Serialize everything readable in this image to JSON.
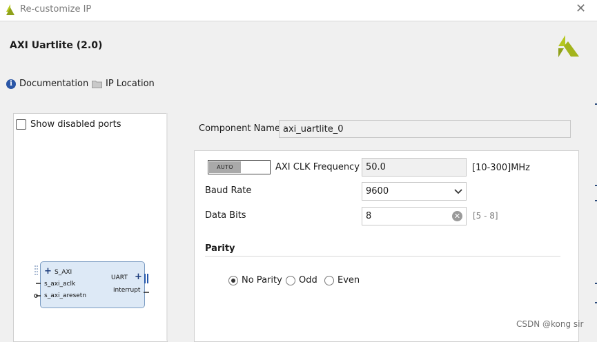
{
  "window": {
    "title": "Re-customize IP"
  },
  "header": {
    "ip_name": "AXI Uartlite (2.0)"
  },
  "links": {
    "documentation": "Documentation",
    "ip_location": "IP Location"
  },
  "left_panel": {
    "show_disabled_ports": "Show disabled ports",
    "block": {
      "left_ports": [
        "S_AXI",
        "s_axi_aclk",
        "s_axi_aresetn"
      ],
      "right_ports": [
        "UART",
        "interrupt"
      ]
    }
  },
  "component": {
    "label": "Component Name",
    "value": "axi_uartlite_0"
  },
  "params": {
    "auto_label": "AUTO",
    "clk": {
      "label": "AXI CLK Frequency",
      "value": "50.0",
      "range": "[10-300]MHz"
    },
    "baud": {
      "label": "Baud Rate",
      "value": "9600"
    },
    "data_bits": {
      "label": "Data Bits",
      "value": "8",
      "range": "[5 - 8]"
    },
    "parity": {
      "heading": "Parity",
      "options": [
        "No Parity",
        "Odd",
        "Even"
      ],
      "selected": "No Parity"
    }
  },
  "watermark": "CSDN @kong sir",
  "colors": {
    "logo": "#b5c71f",
    "info_icon": "#2a56a6",
    "block_fill": "#dde9f6",
    "block_border": "#7a9bc2"
  }
}
